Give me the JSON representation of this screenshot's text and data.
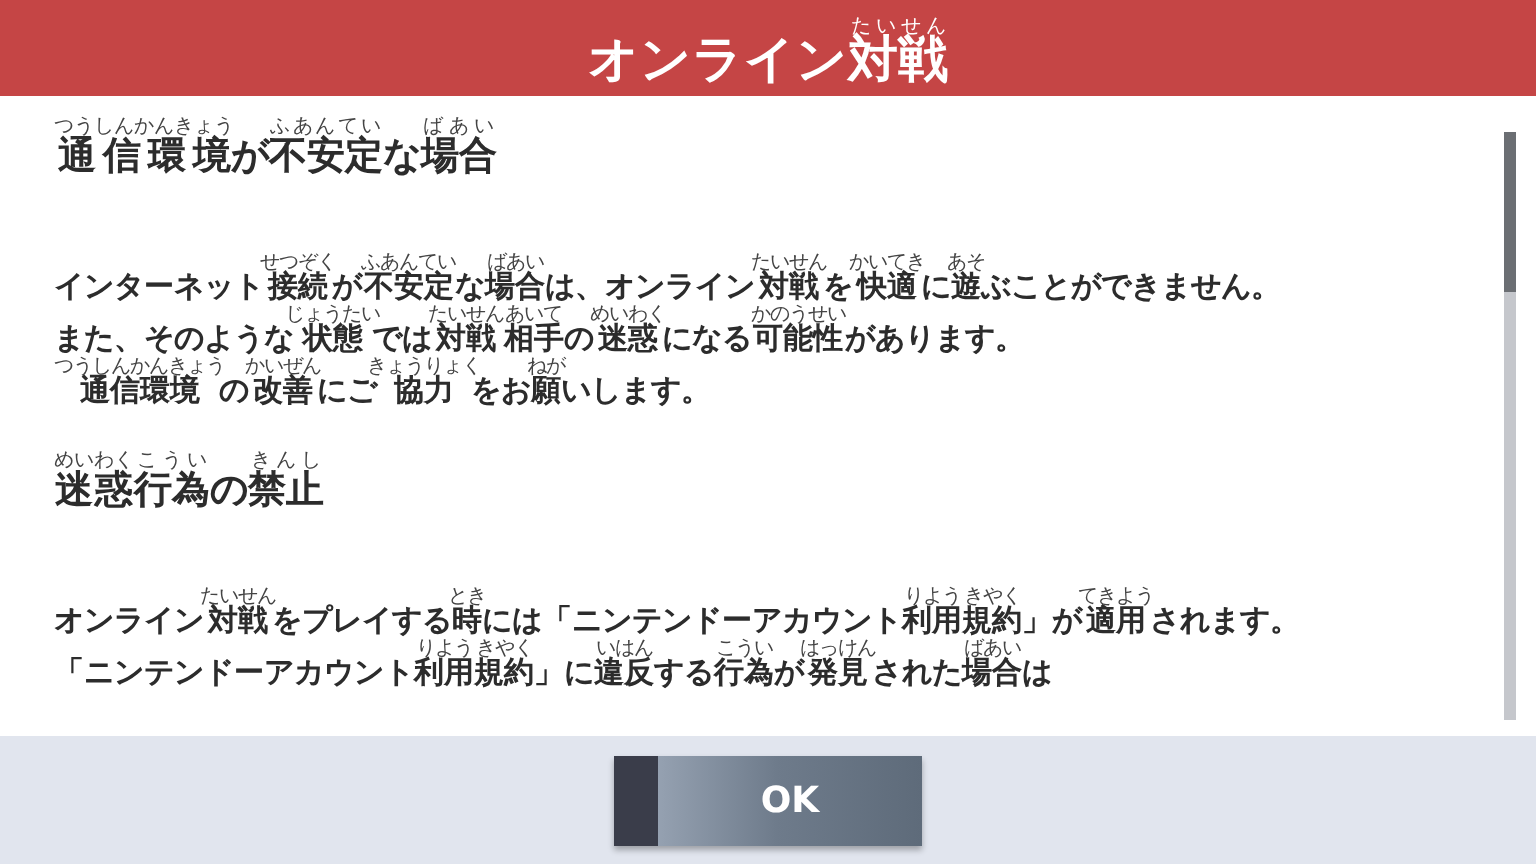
{
  "header": {
    "title": [
      {
        "t": "オンライン"
      },
      {
        "t": "対戦",
        "r": "たいせん"
      }
    ]
  },
  "sections": [
    {
      "heading": [
        {
          "t": "通信環境",
          "r": "つうしんかんきょう"
        },
        {
          "t": "が"
        },
        {
          "t": "不安定",
          "r": "ふあんてい"
        },
        {
          "t": "な"
        },
        {
          "t": "場合",
          "r": "ばあい"
        }
      ],
      "lines": [
        [
          {
            "t": "インターネット"
          },
          {
            "t": "接続",
            "r": "せつぞく"
          },
          {
            "t": "が"
          },
          {
            "t": "不安定",
            "r": "ふあんてい"
          },
          {
            "t": "な"
          },
          {
            "t": "場合",
            "r": "ばあい"
          },
          {
            "t": "は、オンライン"
          },
          {
            "t": "対戦",
            "r": "たいせん"
          },
          {
            "t": "を"
          },
          {
            "t": "快適",
            "r": "かいてき"
          },
          {
            "t": "に"
          },
          {
            "t": "遊",
            "r": "あそ"
          },
          {
            "t": "ぶことができません。"
          }
        ],
        [
          {
            "t": "また、そのような"
          },
          {
            "t": "状態",
            "r": "じょうたい"
          },
          {
            "t": "では"
          },
          {
            "t": "対戦",
            "r": "たいせん"
          },
          {
            "t": "相手",
            "r": "あいて"
          },
          {
            "t": "の"
          },
          {
            "t": "迷惑",
            "r": "めいわく"
          },
          {
            "t": "になる"
          },
          {
            "t": "可能性",
            "r": "かのうせい"
          },
          {
            "t": "があります。"
          }
        ],
        [
          {
            "t": "通信環境",
            "r": "つうしんかんきょう"
          },
          {
            "t": "の"
          },
          {
            "t": "改善",
            "r": "かいぜん"
          },
          {
            "t": "にご"
          },
          {
            "t": "協力",
            "r": "きょうりょく"
          },
          {
            "t": "をお"
          },
          {
            "t": "願",
            "r": "ねが"
          },
          {
            "t": "いします。"
          }
        ]
      ]
    },
    {
      "heading": [
        {
          "t": "迷惑",
          "r": "めいわく"
        },
        {
          "t": "行為",
          "r": "こうい"
        },
        {
          "t": "の"
        },
        {
          "t": "禁止",
          "r": "きんし"
        }
      ],
      "lines": [
        [
          {
            "t": "オンライン"
          },
          {
            "t": "対戦",
            "r": "たいせん"
          },
          {
            "t": "をプレイする"
          },
          {
            "t": "時",
            "r": "とき"
          },
          {
            "t": "には「ニンテンドーアカウント"
          },
          {
            "t": "利用",
            "r": "りよう"
          },
          {
            "t": "規約",
            "r": "きやく"
          },
          {
            "t": "」が"
          },
          {
            "t": "適用",
            "r": "てきよう"
          },
          {
            "t": "されます。"
          }
        ],
        [
          {
            "t": "「ニンテンドーアカウント"
          },
          {
            "t": "利用",
            "r": "りよう"
          },
          {
            "t": "規約",
            "r": "きやく"
          },
          {
            "t": "」に"
          },
          {
            "t": "違反",
            "r": "いはん"
          },
          {
            "t": "する"
          },
          {
            "t": "行為",
            "r": "こうい"
          },
          {
            "t": "が"
          },
          {
            "t": "発見",
            "r": "はっけん"
          },
          {
            "t": "された"
          },
          {
            "t": "場合",
            "r": "ばあい"
          },
          {
            "t": "は"
          }
        ]
      ]
    }
  ],
  "button": {
    "label": "OK"
  }
}
